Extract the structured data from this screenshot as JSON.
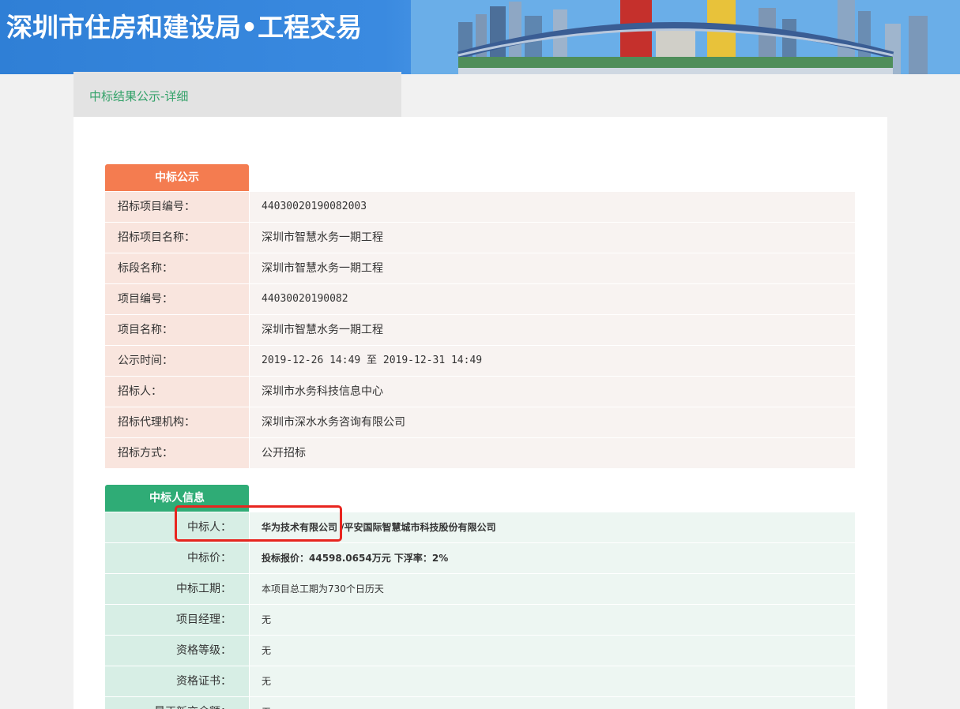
{
  "header": {
    "title": "深圳市住房和建设局•工程交易"
  },
  "breadcrumb": {
    "text": "中标结果公示-详细"
  },
  "section1": {
    "title": "中标公示",
    "rows": [
      {
        "label": "招标项目编号：",
        "value": "44030020190082003"
      },
      {
        "label": "招标项目名称：",
        "value": "深圳市智慧水务一期工程"
      },
      {
        "label": "标段名称：",
        "value": "深圳市智慧水务一期工程"
      },
      {
        "label": "项目编号：",
        "value": "44030020190082"
      },
      {
        "label": "项目名称：",
        "value": "深圳市智慧水务一期工程"
      },
      {
        "label": "公示时间：",
        "value": "2019-12-26 14:49 至 2019-12-31 14:49"
      },
      {
        "label": "招标人：",
        "value": "深圳市水务科技信息中心"
      },
      {
        "label": "招标代理机构：",
        "value": "深圳市深水水务咨询有限公司"
      },
      {
        "label": "招标方式：",
        "value": "公开招标"
      }
    ]
  },
  "section2": {
    "title": "中标人信息",
    "rows": [
      {
        "label": "中标人：",
        "value": "华为技术有限公司 /平安国际智慧城市科技股份有限公司"
      },
      {
        "label": "中标价：",
        "value": "投标报价：44598.0654万元 下浮率：2%"
      },
      {
        "label": "中标工期：",
        "value": "本项目总工期为730个日历天"
      },
      {
        "label": "项目经理：",
        "value": "无"
      },
      {
        "label": "资格等级：",
        "value": "无"
      },
      {
        "label": "资格证书：",
        "value": "无"
      },
      {
        "label": "最正新交金额：",
        "value": "无"
      }
    ]
  },
  "colors": {
    "header_blue": "#2f7fd6",
    "orange_tab": "#f47c50",
    "green_tab": "#2fac76",
    "highlight_red": "#e8251f"
  }
}
